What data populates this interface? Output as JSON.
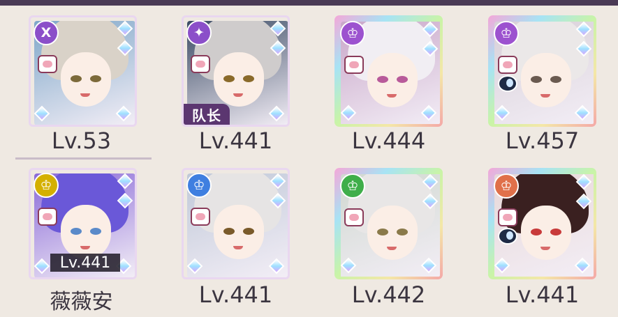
{
  "roster": [
    {
      "level": "Lv.53",
      "element_color": "#8b4fc9",
      "element_icon": "X",
      "hair": "#d9d2c8",
      "eyes": "#7c6a3a",
      "bg": "#7ea7c9",
      "rainbow": false,
      "moon": false
    },
    {
      "level": "Lv.441",
      "element_color": "#8b4fc9",
      "element_icon": "✦",
      "hair": "#cfcccc",
      "eyes": "#8a6a2a",
      "bg": "#3a4a64",
      "rainbow": false,
      "moon": false,
      "captain_label": "队长"
    },
    {
      "level": "Lv.444",
      "element_color": "#9c52cf",
      "element_icon": "♔",
      "hair": "#f1eef3",
      "eyes": "#b85a9a",
      "bg": "#c9a7c9",
      "rainbow": true,
      "moon": false
    },
    {
      "level": "Lv.457",
      "element_color": "#9c52cf",
      "element_icon": "♔",
      "hair": "#ebe8e8",
      "eyes": "#6a5a50",
      "bg": "#d8d0d8",
      "rainbow": true,
      "moon": true
    },
    {
      "level": "Lv.441",
      "element_color": "#d4b000",
      "element_icon": "♔",
      "hair": "#6a58d8",
      "eyes": "#5a8ac9",
      "bg": "#8a6ad8",
      "rainbow": false,
      "moon": false,
      "inner_level": "Lv.441",
      "name": "薇薇安"
    },
    {
      "level": "Lv.441",
      "element_color": "#3f7fe0",
      "element_icon": "♔",
      "hair": "#e6e4e4",
      "eyes": "#7a5a2a",
      "bg": "#bfc8d8",
      "rainbow": false,
      "moon": false
    },
    {
      "level": "Lv.442",
      "element_color": "#3fae4a",
      "element_icon": "♔",
      "hair": "#e8e6e6",
      "eyes": "#8a7a4a",
      "bg": "#d0d8d0",
      "rainbow": true,
      "moon": false
    },
    {
      "level": "Lv.441",
      "element_color": "#e0704a",
      "element_icon": "♔",
      "hair": "#3a2020",
      "eyes": "#c83a3a",
      "bg": "#e8d8d8",
      "rainbow": true,
      "moon": true
    }
  ]
}
